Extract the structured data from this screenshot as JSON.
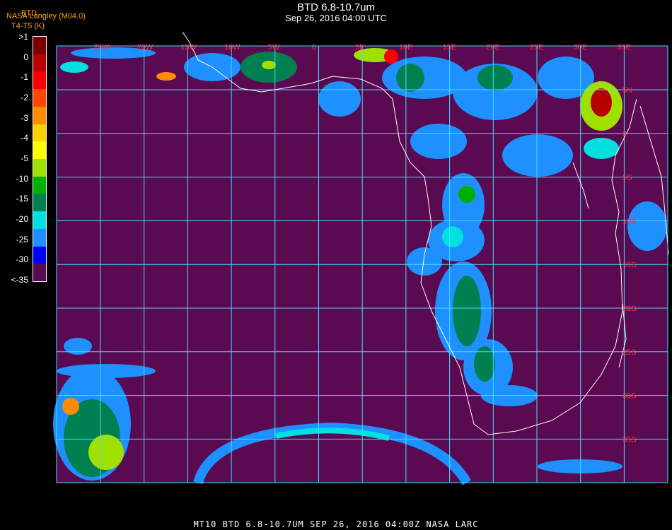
{
  "header": {
    "title": "BTD 6.8-10.7um",
    "subtitle": "Sep 26, 2016 04:00 UTC",
    "credit": "NASA Langley (M04.0)",
    "colorbar_title": "BTD",
    "units": "T4-T5 (K)"
  },
  "colorbar": {
    "labels": [
      ">1",
      "0",
      "-1",
      "-2",
      "-3",
      "-4",
      "-5",
      "-10",
      "-15",
      "-20",
      "-25",
      "-30",
      "<-35"
    ],
    "colors": [
      "#7a0000",
      "#b80000",
      "#ff0000",
      "#ff4500",
      "#ff8c00",
      "#ffd000",
      "#ffff00",
      "#a0e000",
      "#00b000",
      "#008050",
      "#00e0e0",
      "#1e90ff",
      "#0000ff",
      "#5a0a50"
    ]
  },
  "map": {
    "background_color": "#5a0a50",
    "grid_color": "#40e0ff",
    "coast_color": "#ffffff",
    "label_color": "#ff3030",
    "lon_labels": [
      "25W",
      "20W",
      "15W",
      "10W",
      "5W",
      "0",
      "5E",
      "10E",
      "15E",
      "20E",
      "25E",
      "30E",
      "35E"
    ],
    "lat_labels": [
      "5N",
      "0",
      "5S",
      "10S",
      "15S",
      "20S",
      "25S",
      "30S",
      "35S",
      "40S"
    ]
  },
  "footer": {
    "text": "MT10  BTD 6.8-10.7UM   SEP 26, 2016 04:00Z   NASA LARC"
  }
}
